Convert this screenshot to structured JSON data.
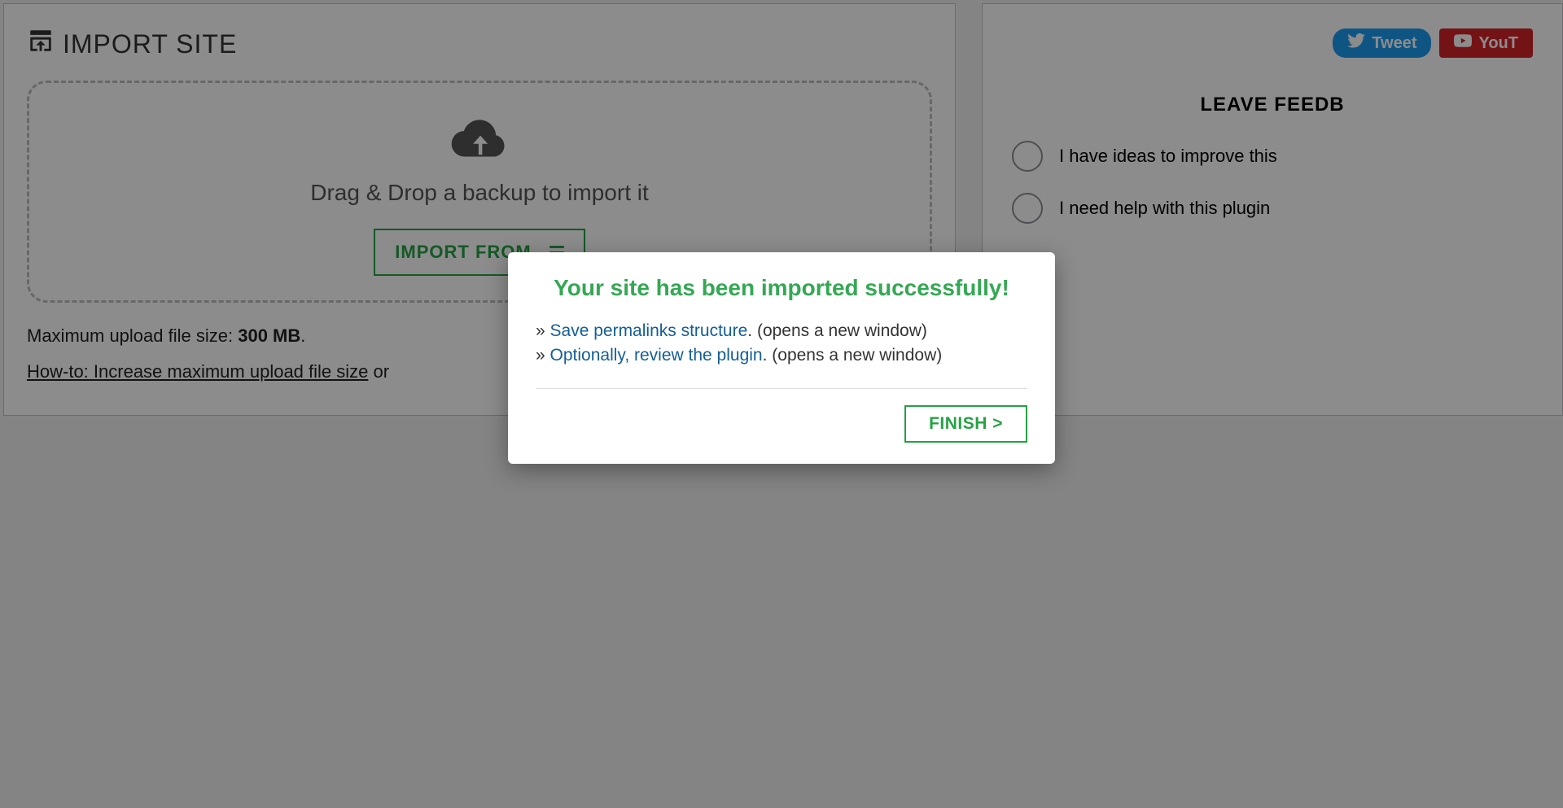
{
  "header": {
    "title": "IMPORT SITE"
  },
  "dropzone": {
    "label": "Drag & Drop a backup to import it",
    "button": "IMPORT FROM"
  },
  "filesize": {
    "label": "Maximum upload file size: ",
    "value": "300 MB",
    "suffix": "."
  },
  "howto": {
    "link": "How-to: Increase maximum upload file size",
    "suffix": " or"
  },
  "sidebar": {
    "tweet": "Tweet",
    "youtube": "YouT",
    "feedback_title": "LEAVE FEEDB",
    "options": [
      "I have ideas to improve this",
      "I need help with this plugin"
    ]
  },
  "modal": {
    "title": "Your site has been imported successfully!",
    "rows": [
      {
        "arrow": "» ",
        "link": "Save permalinks structure",
        "rest": ". (opens a new window)"
      },
      {
        "arrow": "» ",
        "link": "Optionally, review the plugin",
        "rest": ". (opens a new window)"
      }
    ],
    "finish": "FINISH >"
  }
}
